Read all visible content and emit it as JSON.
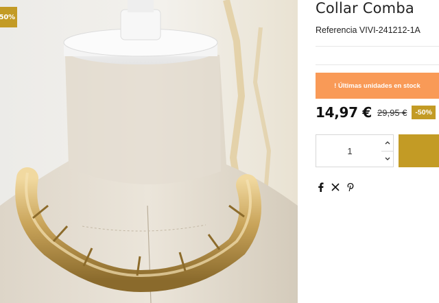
{
  "image": {
    "corner_badge": "50%"
  },
  "product": {
    "title": "Collar Comba",
    "reference": "Referencia VIVI-241212-1A",
    "stock_banner": "! Últimas unidades en stock",
    "price": "14,97 €",
    "old_price": "29,95 €",
    "discount_badge": "-50%",
    "quantity": "1"
  },
  "social": {
    "icons": [
      "facebook-icon",
      "x-twitter-icon",
      "pinterest-icon"
    ]
  },
  "colors": {
    "gold_accent": "#c39b25",
    "stock_banner": "#f99a57",
    "border": "#d7d7d7"
  }
}
